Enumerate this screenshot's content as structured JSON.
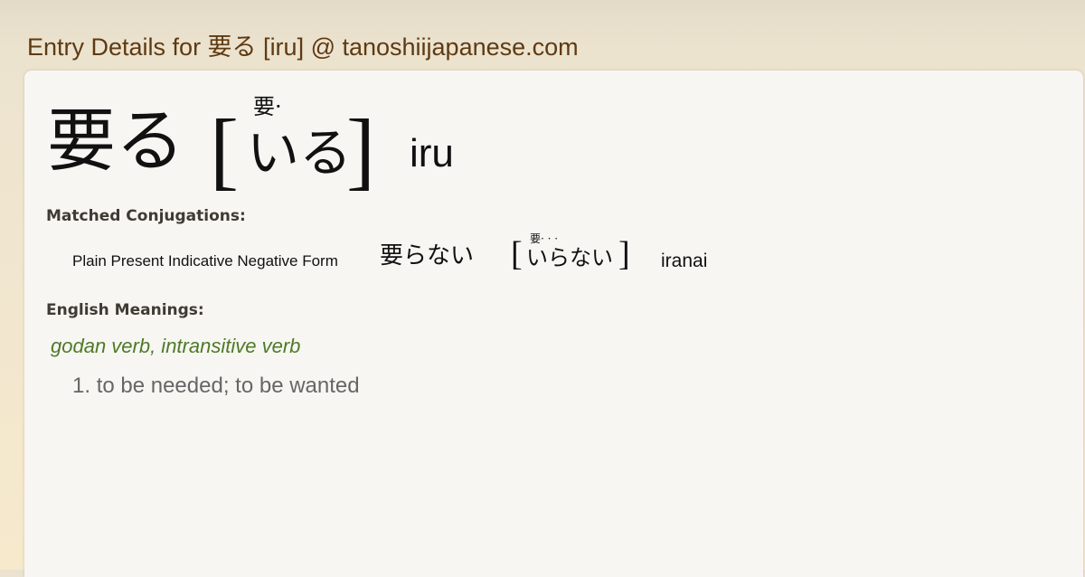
{
  "page": {
    "title": "Entry Details for 要る [iru] @ tanoshiijapanese.com"
  },
  "entry": {
    "headword": "要る",
    "bracket_open": "[",
    "bracket_close": "]",
    "furigana": "要·",
    "reading": "いる",
    "romaji": "iru"
  },
  "conjugations": {
    "heading": "Matched Conjugations:",
    "items": [
      {
        "form": "Plain Present Indicative Negative Form",
        "word": "要らない",
        "furigana": "要·  ·  ·",
        "reading": "いらない",
        "romaji": "iranai"
      }
    ]
  },
  "meanings": {
    "heading": "English Meanings:",
    "part_of_speech": "godan verb, intransitive verb",
    "items": [
      {
        "number": "1.",
        "text": "to be needed; to be wanted"
      }
    ]
  },
  "colors": {
    "title": "#5e3a12",
    "pos": "#4e7a28",
    "meaning": "#666666",
    "panel": "#f7f6f2"
  }
}
